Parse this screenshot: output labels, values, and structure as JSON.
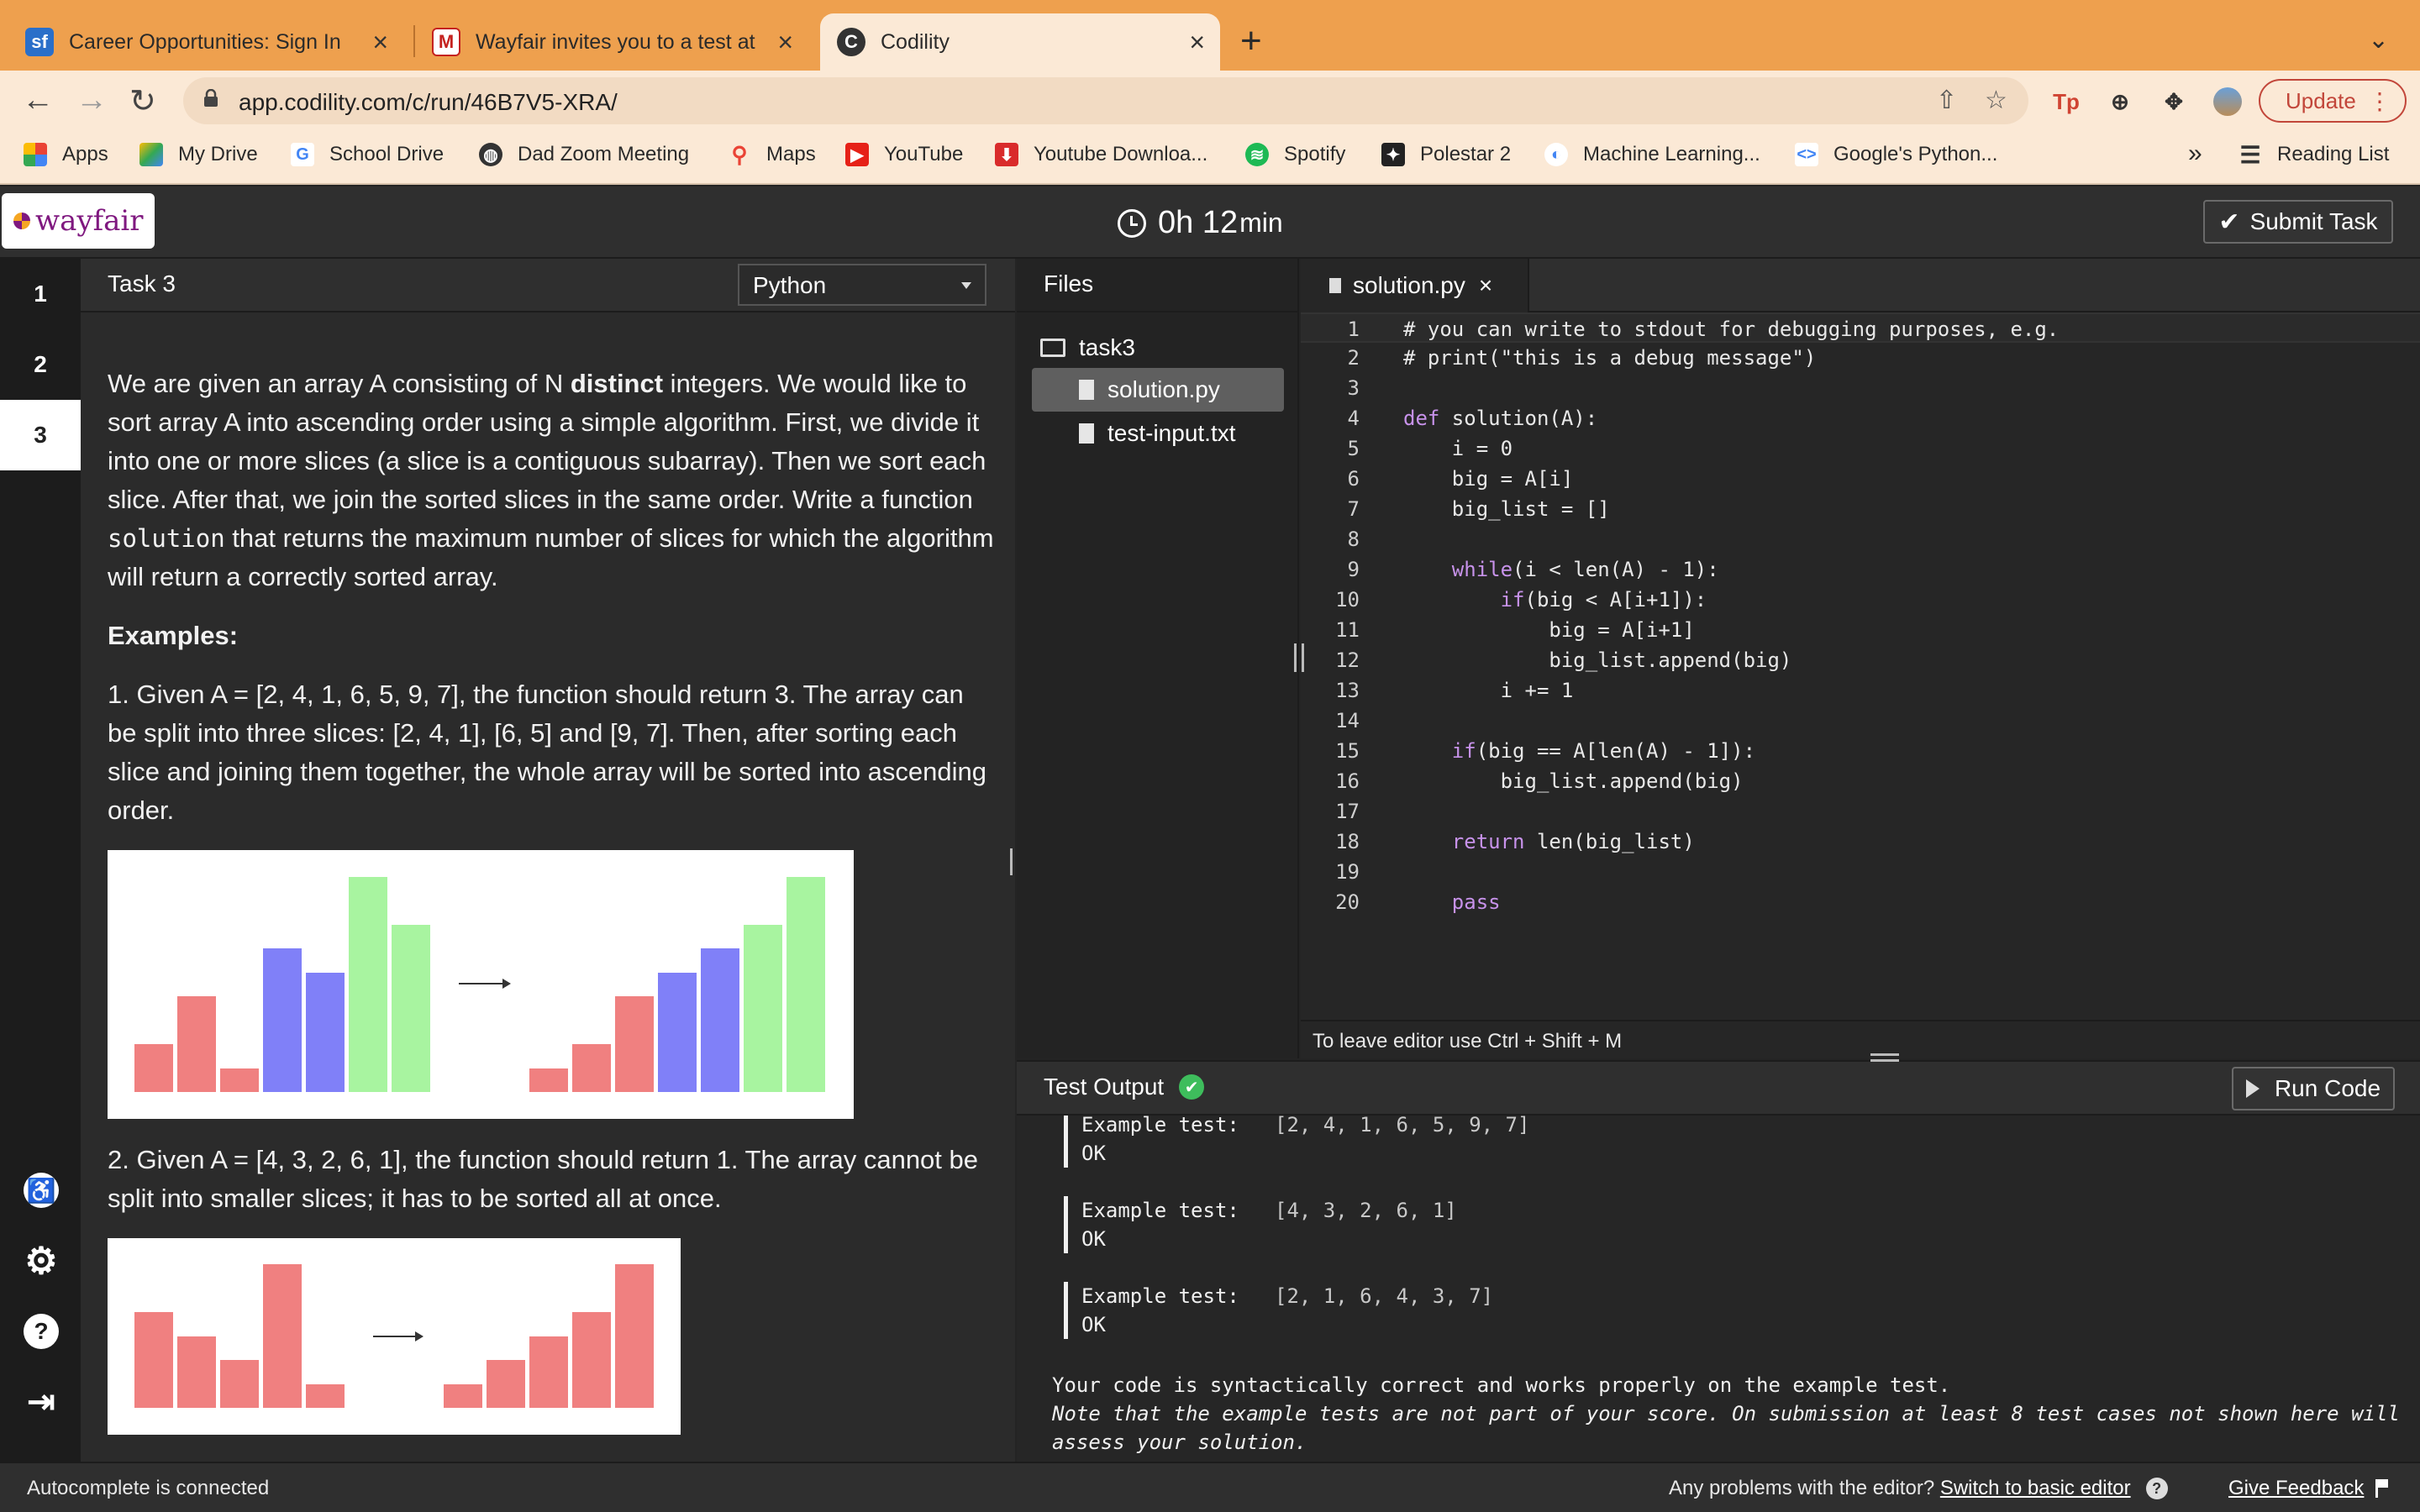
{
  "browser": {
    "tabs": [
      {
        "title": "Career Opportunities: Sign In",
        "favicon": "sf-icon",
        "active": false
      },
      {
        "title": "Wayfair invites you to a test at",
        "favicon": "gmail-icon",
        "active": false
      },
      {
        "title": "Codility",
        "favicon": "codility-icon",
        "active": true
      }
    ],
    "url": "app.codility.com/c/run/46B7V5-XRA/",
    "update_label": "Update",
    "bookmarks": [
      {
        "label": "Apps",
        "icon": "apps-grid-icon"
      },
      {
        "label": "My Drive",
        "icon": "google-drive-icon"
      },
      {
        "label": "School Drive",
        "icon": "google-icon"
      },
      {
        "label": "Dad Zoom Meeting",
        "icon": "globe-icon"
      },
      {
        "label": "Maps",
        "icon": "maps-pin-icon"
      },
      {
        "label": "YouTube",
        "icon": "youtube-icon"
      },
      {
        "label": "Youtube Downloa...",
        "icon": "download-icon"
      },
      {
        "label": "Spotify",
        "icon": "spotify-icon"
      },
      {
        "label": "Polestar 2",
        "icon": "polestar-icon"
      },
      {
        "label": "Machine Learning...",
        "icon": "ml-icon"
      },
      {
        "label": "Google's Python...",
        "icon": "code-icon"
      }
    ],
    "more_bookmarks": "»",
    "reading_list": "Reading List"
  },
  "app": {
    "logo_text": "wayfair",
    "timer_hours": "0h",
    "timer_minutes": "12",
    "timer_unit": "min",
    "submit_label": "Submit Task",
    "task_numbers": [
      "1",
      "2",
      "3"
    ],
    "active_task": "3"
  },
  "task": {
    "title": "Task 3",
    "language": "Python",
    "intro_before_bold": "We are given an array A consisting of N ",
    "intro_bold": "distinct",
    "intro_after_bold": " integers. We would like to sort array A into ascending order using a simple algorithm. First, we divide it into one or more slices (a slice is a contiguous subarray). Then we sort each slice. After that, we join the sorted slices in the same order. Write a function ",
    "intro_code": "solution",
    "intro_end": " that returns the maximum number of slices for which the algorithm will return a correctly sorted array.",
    "examples_heading": "Examples:",
    "example1": "1. Given A = [2, 4, 1, 6, 5, 9, 7], the function should return 3. The array can be split into three slices: [2, 4, 1], [6, 5] and [9, 7]. Then, after sorting each slice and joining them together, the whole array will be sorted into ascending order.",
    "example2": "2. Given A = [4, 3, 2, 6, 1], the function should return 1. The array cannot be split into smaller slices; it has to be sorted all at once.",
    "figure1": {
      "before": [
        2,
        4,
        1,
        6,
        5,
        9,
        7
      ],
      "after": [
        1,
        2,
        4,
        5,
        6,
        7,
        9
      ],
      "colors": {
        "slice1": "#f08080",
        "slice2": "#8080f8",
        "slice3": "#a8f4a0"
      }
    },
    "figure2": {
      "before": [
        4,
        3,
        2,
        6,
        1
      ],
      "after": [
        1,
        2,
        3,
        4,
        6
      ],
      "color": "#f08080"
    }
  },
  "files": {
    "title": "Files",
    "folder": "task3",
    "items": [
      "solution.py",
      "test-input.txt"
    ],
    "selected": "solution.py"
  },
  "editor": {
    "tab_label": "solution.py",
    "hint": "To leave editor use Ctrl + Shift + M",
    "lines": [
      "# you can write to stdout for debugging purposes, e.g.",
      "# print(\"this is a debug message\")",
      "",
      "def solution(A):",
      "    i = 0",
      "    big = A[i]",
      "    big_list = []",
      "",
      "    while(i < len(A) - 1):",
      "        if(big < A[i+1]):",
      "            big = A[i+1]",
      "            big_list.append(big)",
      "        i += 1",
      "",
      "    if(big == A[len(A) - 1]):",
      "        big_list.append(big)",
      "",
      "    return len(big_list)",
      "",
      "    pass"
    ]
  },
  "output": {
    "title": "Test Output",
    "run_label": "Run Code",
    "tests": [
      {
        "label": "Example test:",
        "input": "[2, 4, 1, 6, 5, 9, 7]",
        "result": "OK"
      },
      {
        "label": "Example test:",
        "input": "[4, 3, 2, 6, 1]",
        "result": "OK"
      },
      {
        "label": "Example test:",
        "input": "[2, 1, 6, 4, 3, 7]",
        "result": "OK"
      }
    ],
    "summary": "Your code is syntactically correct and works properly on the example test.",
    "note": "Note that the example tests are not part of your score. On submission at least 8 test cases not shown here will assess your solution."
  },
  "status": {
    "autocomplete": "Autocomplete is connected",
    "problems_text": "Any problems with the editor?",
    "switch_link": "Switch to basic editor",
    "feedback": "Give Feedback"
  }
}
